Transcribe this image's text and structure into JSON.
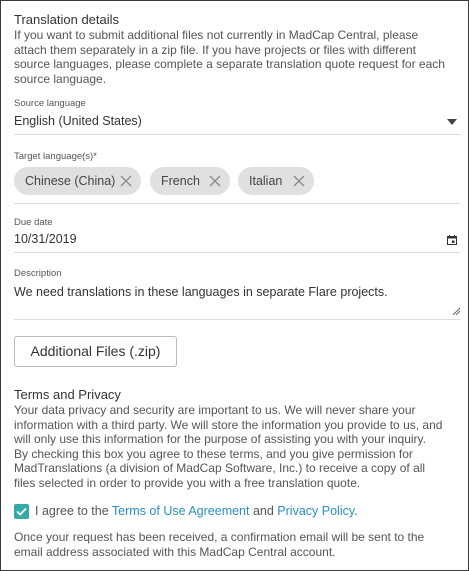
{
  "translation_details": {
    "title": "Translation details",
    "lines": [
      "If you want to submit additional files not currently in MadCap Central, please",
      "attach them separately in a zip file. If you have projects or files with different",
      "source languages, please complete a separate translation quote request for each",
      "source language."
    ]
  },
  "source_language": {
    "label": "Source language",
    "value": "English (United States)"
  },
  "target_languages": {
    "label": "Target language(s)*",
    "chips": [
      "Chinese (China)",
      "French",
      "Italian"
    ]
  },
  "due_date": {
    "label": "Due date",
    "value": "10/31/2019"
  },
  "description": {
    "label": "Description",
    "value": "We need translations in these languages in separate Flare projects."
  },
  "additional_files_button": "Additional Files (.zip)",
  "terms": {
    "title": "Terms and Privacy",
    "lines": [
      "Your data privacy and security are important to us. We will never share your",
      "information with a third party. We will store the information you provide to us, and",
      "will only use this information for the purpose of assisting you with your inquiry.",
      "By checking this box you agree to these terms, and you give permission for",
      "MadTranslations (a division of MadCap Software, Inc.) to receive a copy of all",
      "files selected in order to provide you with a free translation quote."
    ]
  },
  "agreement": {
    "checked": true,
    "prefix": "I agree to the ",
    "terms_link": "Terms of Use Agreement",
    "middle": " and ",
    "privacy_link": "Privacy Policy",
    "suffix": "."
  },
  "confirmation": {
    "lines": [
      "Once your request has been received, a confirmation email will be sent to the",
      "email address associated with this MadCap Central account."
    ]
  },
  "colors": {
    "checkbox": "#37a9a6",
    "link": "#2a8fbd",
    "chip": "#e0e0e0"
  },
  "icons": [
    "dropdown-arrow-icon",
    "chip-remove-icon",
    "calendar-icon",
    "resize-handle-icon",
    "checkmark-icon"
  ]
}
